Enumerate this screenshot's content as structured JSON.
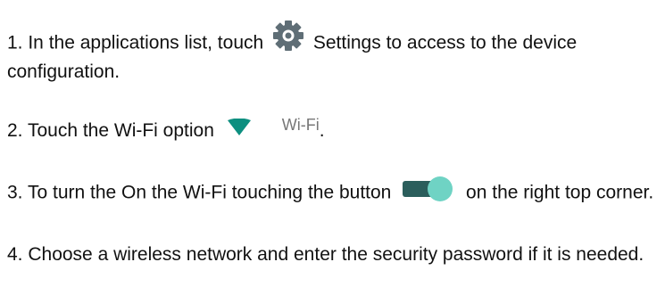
{
  "steps": [
    {
      "text_before": "1. In the applications list, touch ",
      "icon": "settings-gear-icon",
      "text_after": " Settings to access to the device configuration."
    },
    {
      "text_before": "2. Touch the Wi-Fi option ",
      "icon": "wifi-icon",
      "icon_label": "Wi-Fi",
      "text_after": "."
    },
    {
      "text_before": "3. To turn the On the Wi-Fi touching the button ",
      "icon": "toggle-switch-icon",
      "text_after": " on the right top corner."
    },
    {
      "text_before": "4. Choose a wireless network and enter the security password if it is needed."
    }
  ],
  "colors": {
    "gear": "#5f6e76",
    "wifi": "#0d8f80",
    "toggle_track": "#2b5e5c",
    "toggle_knob": "#6fd3c4"
  }
}
